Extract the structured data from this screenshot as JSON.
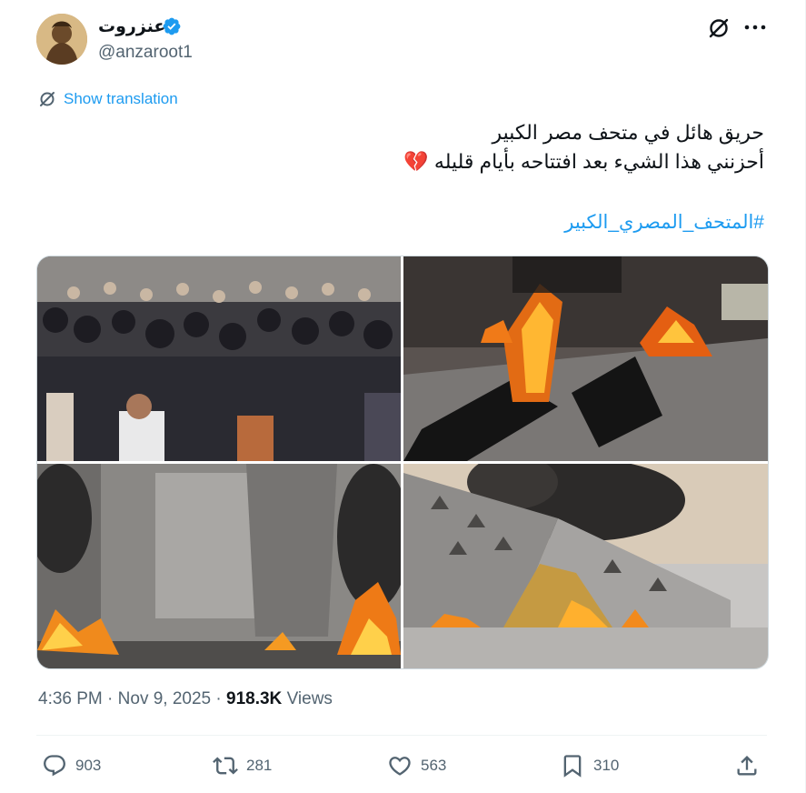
{
  "author": {
    "display_name": "عنزروت",
    "handle": "@anzaroot1",
    "verified": true
  },
  "translate_label": "Show translation",
  "tweet": {
    "lines": [
      "حريق هائل في متحف مصر الكبير",
      "أحزنني هذا الشيء بعد افتتاحه بأيام قليله 💔"
    ],
    "hashtag": "#المتحف_المصري_الكبير"
  },
  "media": [
    {
      "icon": "crowd-photo"
    },
    {
      "icon": "fire-photo"
    },
    {
      "icon": "fire-interior-photo"
    },
    {
      "icon": "fire-facade-photo"
    }
  ],
  "meta": {
    "time": "4:36 PM",
    "sep1": "·",
    "date": "Nov 9, 2025",
    "sep2": "·",
    "views_count": "918.3K",
    "views_label": "Views"
  },
  "actions": {
    "replies": "903",
    "reposts": "281",
    "likes": "563",
    "bookmarks": "310"
  },
  "colors": {
    "accent": "#1d9bf0",
    "muted": "#536471",
    "text": "#0f1419",
    "border": "#cfd9de"
  }
}
